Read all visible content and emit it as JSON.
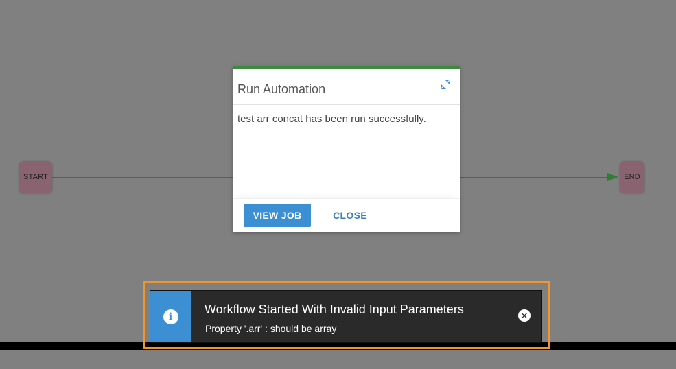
{
  "canvas": {
    "start_node_label": "START",
    "end_node_label": "END"
  },
  "modal": {
    "title": "Run Automation",
    "expand_icon": "expand-icon",
    "body_text": "test arr concat has been run successfully.",
    "view_job_label": "VIEW JOB",
    "close_label": "CLOSE"
  },
  "toast": {
    "icon": "info-icon",
    "info_glyph": "i",
    "close_glyph": "✕",
    "title": "Workflow Started With Invalid Input Parameters",
    "message": "Property '.arr' : should be array"
  },
  "colors": {
    "overlay": "#808080",
    "modal_accent": "#3c8a3e",
    "primary_button": "#3d8fd4",
    "link_button": "#3a7fc2",
    "toast_background": "#2a2a2a",
    "highlight_border": "#f0962a",
    "node_fill": "#8a6370",
    "connector": "#2e7d32"
  }
}
